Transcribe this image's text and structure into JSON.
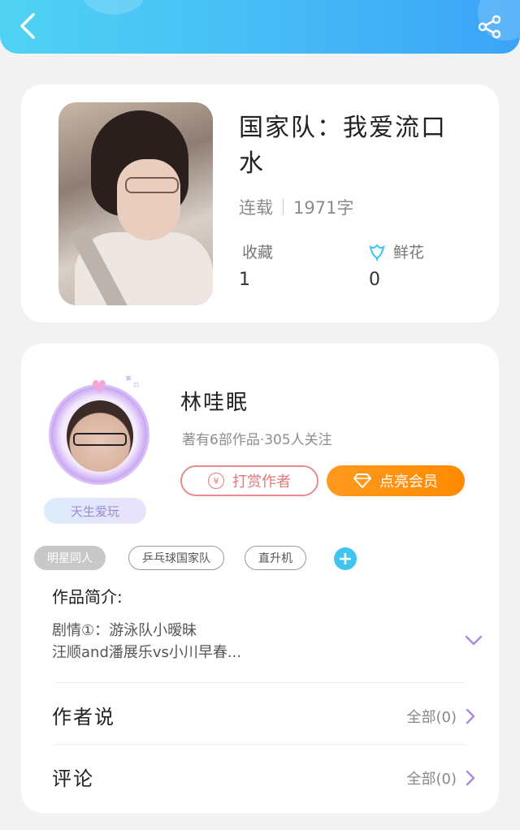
{
  "header": {
    "back_icon": "back-chevron-icon",
    "share_icon": "share-icon",
    "colors": {
      "start": "#4fd3f3",
      "end": "#3aa3f7"
    }
  },
  "book": {
    "title": "国家队：我爱流口水",
    "status": "连载",
    "word_count": "1971字",
    "favorites_label": "收藏",
    "favorites_value": "1",
    "flowers_label": "鲜花",
    "flowers_icon": "flower-icon",
    "flowers_value": "0"
  },
  "author": {
    "name": "林哇眠",
    "stats": "著有6部作品·305人关注",
    "badge": "天生爱玩",
    "tip_button": "打赏作者",
    "vip_button": "点亮会员",
    "accent_color": "#ff8a00"
  },
  "tags": [
    "明星同人",
    "乒乓球国家队",
    "直升机"
  ],
  "intro": {
    "label": "作品简介:",
    "text": "剧情①：游泳队小暧昧\n汪顺and潘展乐vs小川早春..."
  },
  "sections": {
    "author_says": {
      "label": "作者说",
      "link": "全部(0)"
    },
    "comments": {
      "label": "评论",
      "link": "全部(0)"
    }
  }
}
